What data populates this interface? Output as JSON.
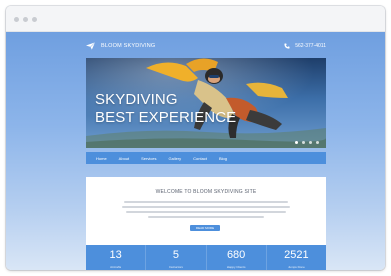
{
  "window": {
    "controls": [
      "close",
      "minimize",
      "maximize"
    ]
  },
  "site": {
    "logo_text": "BLOOM SKYDIVING",
    "phone": "562-377-4011",
    "colors": {
      "accent": "#4d8fdc",
      "sky": "#8db5ea",
      "text_muted": "#5b6270"
    }
  },
  "hero": {
    "title_line1": "SKYDIVING",
    "title_line2": "BEST EXPERIENCE",
    "slides": 4,
    "active_slide": 1
  },
  "nav": {
    "items": [
      "Home",
      "About",
      "Services",
      "Gallery",
      "Contact",
      "Blog"
    ]
  },
  "welcome": {
    "title": "WELCOME TO BLOOM SKYDIVING SITE",
    "button_label": "READ MORE"
  },
  "stats": [
    {
      "value": "13",
      "label": "Aircrafts"
    },
    {
      "value": "5",
      "label": "Instructors"
    },
    {
      "value": "680",
      "label": "Happy Clients"
    },
    {
      "value": "2521",
      "label": "Jumps Done"
    }
  ]
}
